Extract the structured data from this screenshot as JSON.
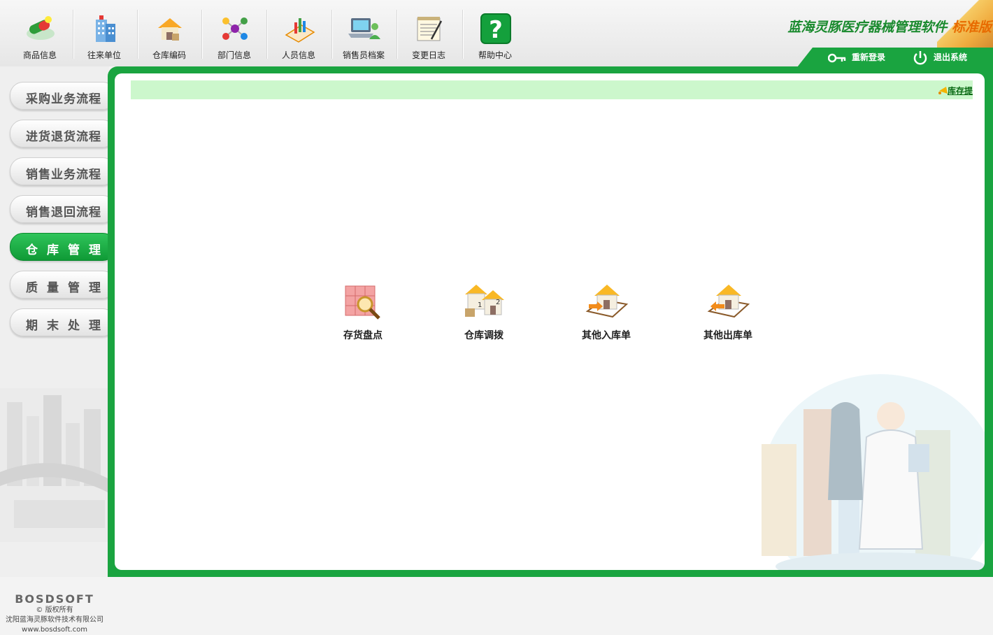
{
  "toolbar": {
    "items": [
      {
        "label": "商品信息",
        "icon": "pill-icon"
      },
      {
        "label": "往来单位",
        "icon": "building-icon"
      },
      {
        "label": "仓库编码",
        "icon": "warehouse-icon"
      },
      {
        "label": "部门信息",
        "icon": "molecule-icon"
      },
      {
        "label": "人员信息",
        "icon": "chart-icon"
      },
      {
        "label": "销售员档案",
        "icon": "laptop-user-icon"
      },
      {
        "label": "变更日志",
        "icon": "notepad-icon"
      },
      {
        "label": "帮助中心",
        "icon": "help-icon"
      }
    ]
  },
  "brand": {
    "title": "蓝海灵豚医疗器械管理软件",
    "edition": "标准版"
  },
  "session": {
    "relogin": "重新登录",
    "exit": "退出系统"
  },
  "sidebar": {
    "items": [
      {
        "label": "采购业务流程",
        "active": false
      },
      {
        "label": "进货退货流程",
        "active": false
      },
      {
        "label": "销售业务流程",
        "active": false
      },
      {
        "label": "销售退回流程",
        "active": false
      },
      {
        "label": "仓库管理",
        "active": true
      },
      {
        "label": "质量管理",
        "active": false
      },
      {
        "label": "期末处理",
        "active": false
      }
    ],
    "footer": {
      "logo": "BOSDSOFT",
      "copyright": "© 版权所有",
      "company": "沈阳蓝海灵豚软件技术有限公司",
      "url": "www.bosdsoft.com"
    }
  },
  "main": {
    "notice_link": "库存提",
    "functions": [
      {
        "label": "存货盘点",
        "icon": "stocktake-icon"
      },
      {
        "label": "仓库调拨",
        "icon": "warehouse-transfer-icon"
      },
      {
        "label": "其他入库单",
        "icon": "warehouse-in-icon"
      },
      {
        "label": "其他出库单",
        "icon": "warehouse-out-icon"
      }
    ]
  },
  "colors": {
    "accent": "#1aa440",
    "notice_bg": "#ccf7cc",
    "brand_orange": "#e86b00"
  }
}
